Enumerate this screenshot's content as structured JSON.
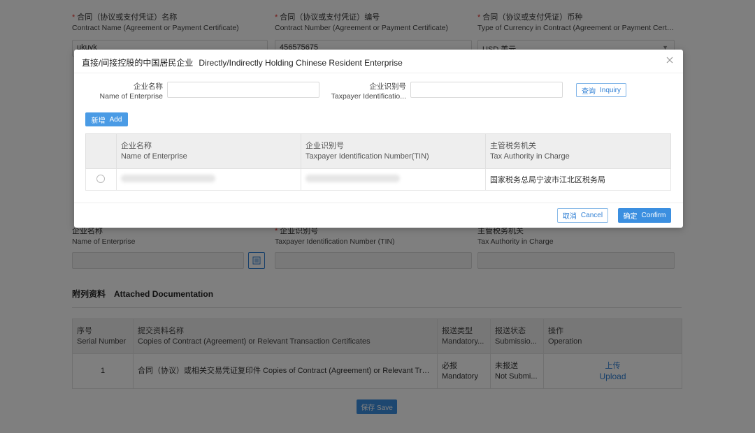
{
  "form": {
    "contract_name": {
      "label_cn": "合同（协议或支付凭证）名称",
      "label_en": "Contract Name (Agreement or Payment Certificate)",
      "value": "ukuyk"
    },
    "contract_number": {
      "label_cn": "合同（协议或支付凭证）编号",
      "label_en": "Contract Number (Agreement or Payment Certificate)",
      "value": "456575675"
    },
    "currency": {
      "label_cn": "合同（协议或支付凭证）币种",
      "label_en": "Type of Currency in Contract (Agreement or Payment Certificate)",
      "value": "USD 美元"
    },
    "holding_enterprise": {
      "name_cn": "企业名称",
      "name_en": "Name of Enterprise",
      "tin_cn": "企业识别号",
      "tin_en": "Taxpayer Identification Number (TIN)",
      "authority_cn": "主管税务机关",
      "authority_en": "Tax Authority in Charge"
    }
  },
  "attachments": {
    "title_cn": "附列资料",
    "title_en": "Attached Documentation",
    "columns": [
      {
        "cn": "序号",
        "en": "Serial Number"
      },
      {
        "cn": "提交资料名称",
        "en": "Copies of Contract (Agreement) or Relevant Transaction Certificates"
      },
      {
        "cn": "报送类型",
        "en": "Mandatory..."
      },
      {
        "cn": "报送状态",
        "en": "Submissio..."
      },
      {
        "cn": "操作",
        "en": "Operation"
      }
    ],
    "rows": [
      {
        "serial": "1",
        "name": "合同（协议）或相关交易凭证复印件 Copies of Contract (Agreement) or Relevant Transaction Vouchers",
        "type_cn": "必报",
        "type_en": "Mandatory",
        "status_cn": "未报送",
        "status_en": "Not Submi...",
        "action_cn": "上传",
        "action_en": "Upload"
      }
    ],
    "save_label": "保存 Save"
  },
  "modal": {
    "title_cn": "直接/间接控股的中国居民企业",
    "title_en": "Directly/Indirectly Holding Chinese Resident Enterprise",
    "query": {
      "name_label_cn": "企业名称",
      "name_label_en": "Name of Enterprise",
      "name_value": "",
      "tin_label_cn": "企业识别号",
      "tin_label_en": "Taxpayer Identificatio...",
      "tin_value": "",
      "inquiry_cn": "查询",
      "inquiry_en": "Inquiry"
    },
    "add_cn": "新增",
    "add_en": "Add",
    "table": {
      "columns": [
        {
          "cn": "企业名称",
          "en": "Name of Enterprise"
        },
        {
          "cn": "企业识别号",
          "en": "Taxpayer Identification Number(TIN)"
        },
        {
          "cn": "主管税务机关",
          "en": "Tax Authority in Charge"
        }
      ],
      "rows": [
        {
          "tax_authority": "国家税务总局宁波市江北区税务局"
        }
      ]
    },
    "cancel_cn": "取消",
    "cancel_en": "Cancel",
    "confirm_cn": "确定",
    "confirm_en": "Confirm",
    "icons": {
      "close": "close-icon",
      "picker": "list-icon"
    }
  },
  "colors": {
    "primary": "#3b8fe0",
    "required": "#e5342f",
    "overlay": "rgba(0,0,0,0.5)"
  }
}
